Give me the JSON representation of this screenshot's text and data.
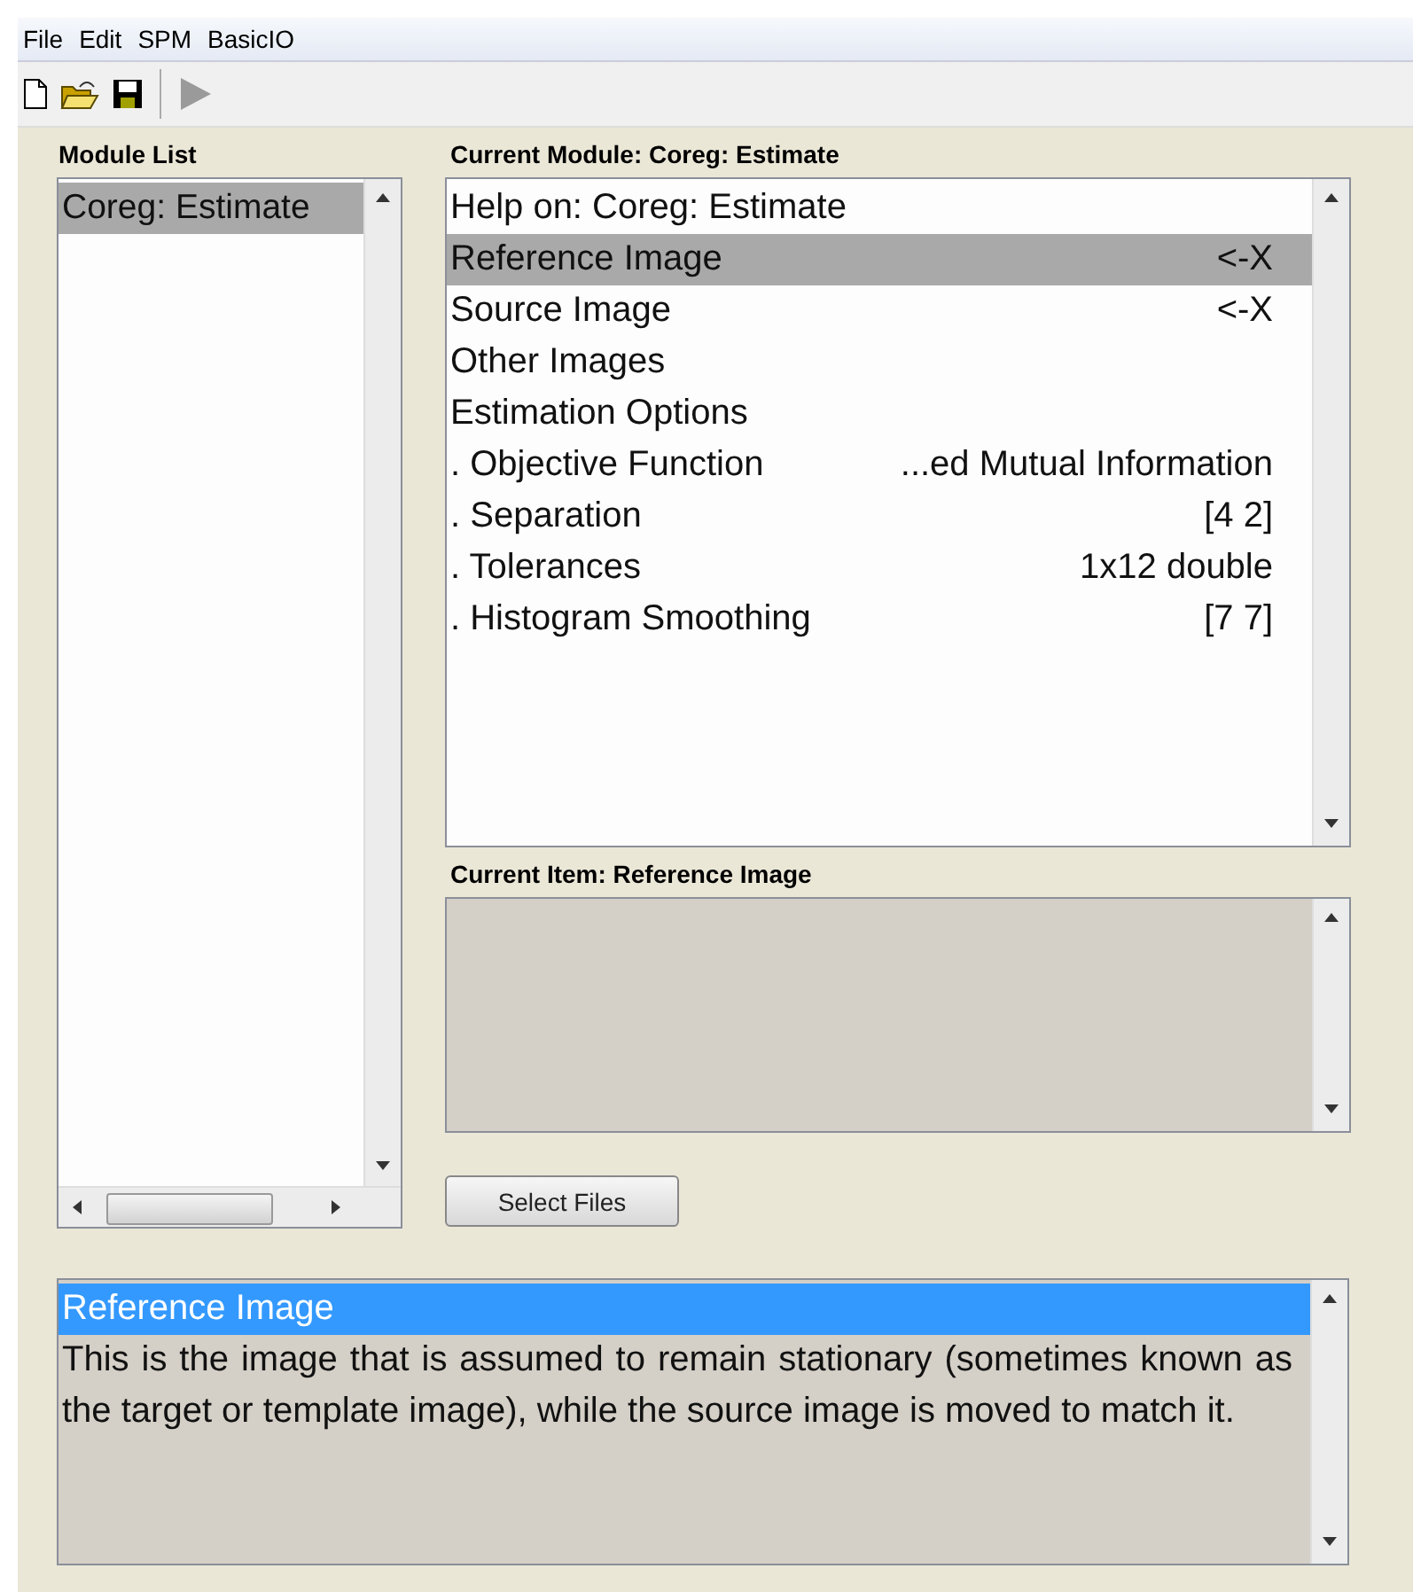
{
  "menu": [
    "File",
    "Edit",
    "SPM",
    "BasicIO"
  ],
  "toolbar": [
    {
      "kind": "new",
      "disabled": false
    },
    {
      "kind": "open",
      "disabled": false
    },
    {
      "kind": "save",
      "disabled": false
    },
    {
      "kind": "separator"
    },
    {
      "kind": "run",
      "disabled": true
    }
  ],
  "module_list": {
    "title": "Module List",
    "items": [
      {
        "label": "Coreg: Estimate",
        "selected": true
      }
    ]
  },
  "current_module": {
    "title": "Current Module: Coreg: Estimate",
    "items": [
      {
        "label": "Help on: Coreg: Estimate",
        "selected": false
      },
      {
        "label": "Reference Image",
        "value": "<-X",
        "selected": true
      },
      {
        "label": "Source Image",
        "value": "<-X",
        "selected": false
      },
      {
        "label": "Other Images",
        "selected": false
      },
      {
        "label": "Estimation Options",
        "selected": false
      },
      {
        "label": ". Objective Function",
        "value": "...ed Mutual Information",
        "selected": false
      },
      {
        "label": ". Separation",
        "value": "[4 2]",
        "selected": false
      },
      {
        "label": ". Tolerances",
        "value": "1x12 double",
        "selected": false
      },
      {
        "label": ". Histogram Smoothing",
        "value": "[7 7]",
        "selected": false
      }
    ]
  },
  "current_item": {
    "title": "Current Item: Reference Image"
  },
  "select_button": "Select Files",
  "help": {
    "heading": "Reference Image",
    "text": "This is the image that is assumed to remain stationary (sometimes known as the target or template image), while the source image is moved to match it."
  }
}
